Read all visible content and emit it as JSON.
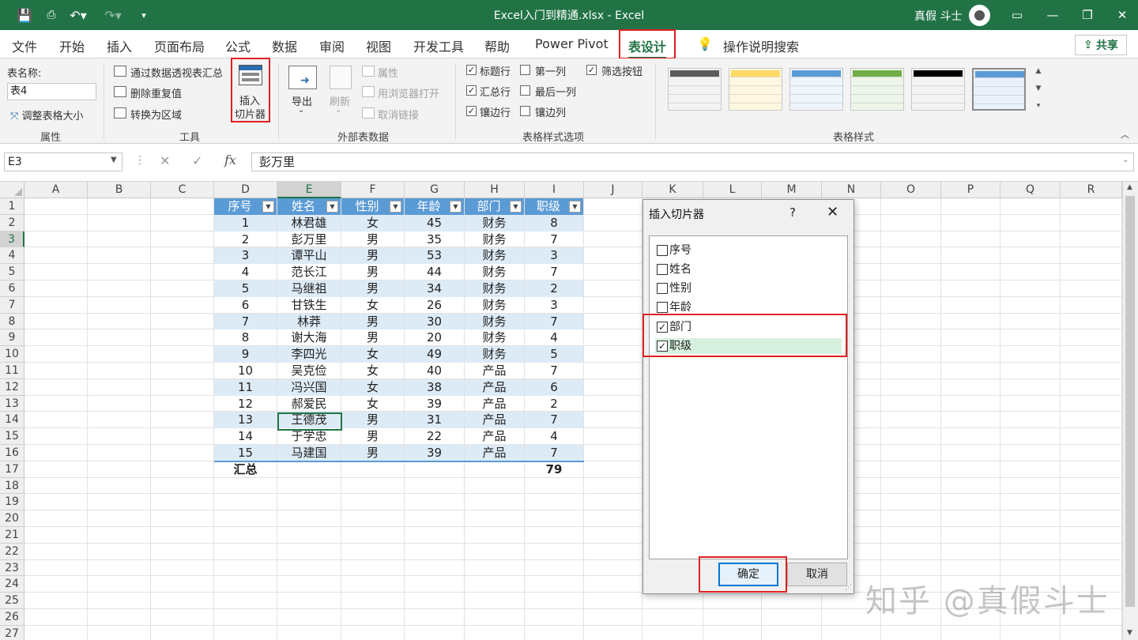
{
  "window": {
    "title": "Excel入门到精通.xlsx  -  Excel",
    "user": "真假 斗士"
  },
  "tabs": [
    {
      "label": "文件"
    },
    {
      "label": "开始"
    },
    {
      "label": "插入"
    },
    {
      "label": "页面布局"
    },
    {
      "label": "公式"
    },
    {
      "label": "数据"
    },
    {
      "label": "审阅"
    },
    {
      "label": "视图"
    },
    {
      "label": "开发工具"
    },
    {
      "label": "帮助"
    },
    {
      "label": "Power Pivot"
    },
    {
      "label": "表设计"
    }
  ],
  "tell_me": "操作说明搜索",
  "share": "共享",
  "ribbon": {
    "properties": {
      "table_name_label": "表名称:",
      "table_name_value": "表4",
      "resize": "调整表格大小",
      "group": "属性"
    },
    "tools": {
      "pivot": "通过数据透视表汇总",
      "remove_dup": "删除重复值",
      "convert": "转换为区域",
      "slicer_line1": "插入",
      "slicer_line2": "切片器",
      "group": "工具"
    },
    "external": {
      "export": "导出",
      "refresh": "刷新",
      "properties": "属性",
      "open_browser": "用浏览器打开",
      "unlink": "取消链接",
      "group": "外部表数据"
    },
    "style_options": {
      "header_row": "标题行",
      "first_col": "第一列",
      "filter_btn": "筛选按钮",
      "total_row": "汇总行",
      "last_col": "最后一列",
      "banded_rows": "镶边行",
      "banded_cols": "镶边列",
      "group": "表格样式选项"
    },
    "styles": {
      "group": "表格样式",
      "thumbs": [
        "#5b5b5b",
        "#ffd966",
        "#5b9bd5",
        "#70ad47",
        "#000000",
        "#5b9bd5"
      ]
    }
  },
  "formula": {
    "namebox": "E3",
    "fx": "fx",
    "value": "彭万里"
  },
  "columns": [
    "A",
    "B",
    "C",
    "D",
    "E",
    "F",
    "G",
    "H",
    "I",
    "J",
    "K",
    "L",
    "M",
    "N",
    "O",
    "P",
    "Q",
    "R"
  ],
  "rows": [
    "1",
    "2",
    "3",
    "4",
    "5",
    "6",
    "7",
    "8",
    "9",
    "10",
    "11",
    "12",
    "13",
    "14",
    "15",
    "16",
    "17",
    "18",
    "19",
    "20",
    "21",
    "22",
    "23",
    "24",
    "25",
    "26",
    "27"
  ],
  "table": {
    "headers": [
      "序号",
      "姓名",
      "性别",
      "年龄",
      "部门",
      "职级"
    ],
    "rows": [
      [
        "1",
        "林君雄",
        "女",
        "45",
        "财务",
        "8"
      ],
      [
        "2",
        "彭万里",
        "男",
        "35",
        "财务",
        "7"
      ],
      [
        "3",
        "谭平山",
        "男",
        "53",
        "财务",
        "3"
      ],
      [
        "4",
        "范长江",
        "男",
        "44",
        "财务",
        "7"
      ],
      [
        "5",
        "马继祖",
        "男",
        "34",
        "财务",
        "2"
      ],
      [
        "6",
        "甘铁生",
        "女",
        "26",
        "财务",
        "3"
      ],
      [
        "7",
        "林莽",
        "男",
        "30",
        "财务",
        "7"
      ],
      [
        "8",
        "谢大海",
        "男",
        "20",
        "财务",
        "4"
      ],
      [
        "9",
        "李四光",
        "女",
        "49",
        "财务",
        "5"
      ],
      [
        "10",
        "吴克俭",
        "女",
        "40",
        "产品",
        "7"
      ],
      [
        "11",
        "冯兴国",
        "女",
        "38",
        "产品",
        "6"
      ],
      [
        "12",
        "郝爱民",
        "女",
        "39",
        "产品",
        "2"
      ],
      [
        "13",
        "王德茂",
        "男",
        "31",
        "产品",
        "7"
      ],
      [
        "14",
        "于学忠",
        "男",
        "22",
        "产品",
        "4"
      ],
      [
        "15",
        "马建国",
        "男",
        "39",
        "产品",
        "7"
      ]
    ],
    "total_label": "汇总",
    "total_value": "79"
  },
  "dialog": {
    "title": "插入切片器",
    "help": "?",
    "close": "✕",
    "items": [
      {
        "label": "序号",
        "checked": false
      },
      {
        "label": "姓名",
        "checked": false
      },
      {
        "label": "性别",
        "checked": false
      },
      {
        "label": "年龄",
        "checked": false
      },
      {
        "label": "部门",
        "checked": true
      },
      {
        "label": "职级",
        "checked": true
      }
    ],
    "ok": "确定",
    "cancel": "取消"
  },
  "watermark": "知乎 @真假斗士"
}
